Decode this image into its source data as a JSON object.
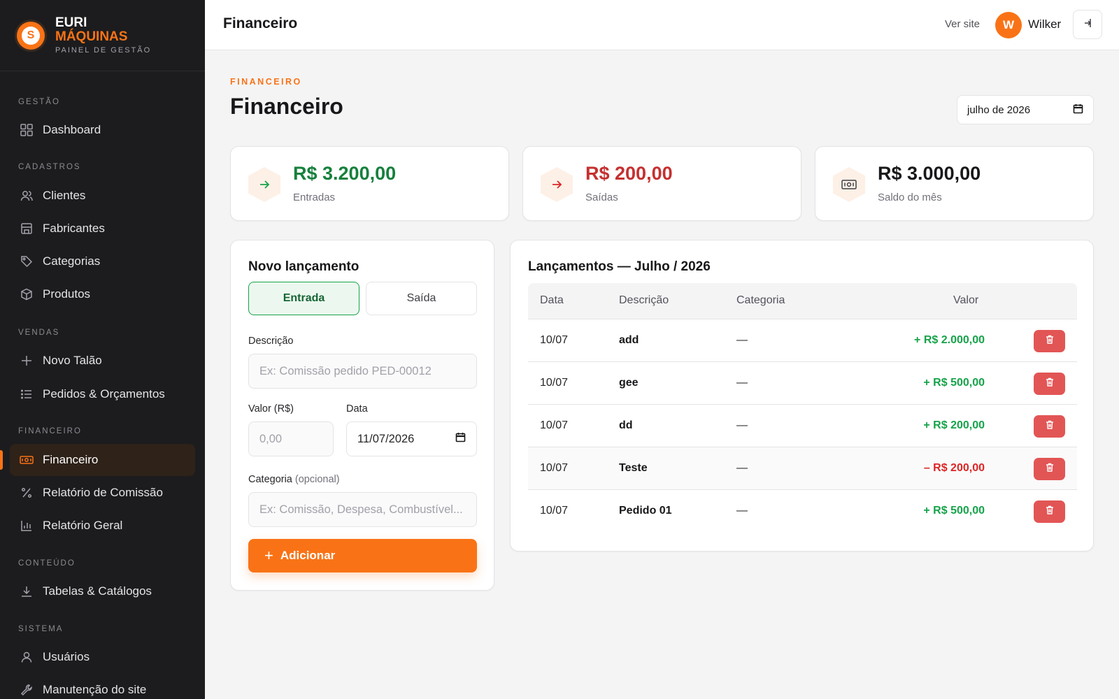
{
  "brand": {
    "line1": "EURI",
    "line2": "MÁQUINAS",
    "tagline": "PAINEL DE GESTÃO",
    "logo_letter": "S"
  },
  "sidebar": {
    "sections": {
      "gestao": "GESTÃO",
      "cadastros": "CADASTROS",
      "vendas": "VENDAS",
      "financeiro": "FINANCEIRO",
      "conteudo": "CONTEÚDO",
      "sistema": "SISTEMA"
    },
    "items": {
      "dashboard": "Dashboard",
      "clientes": "Clientes",
      "fabricantes": "Fabricantes",
      "categorias": "Categorias",
      "produtos": "Produtos",
      "novo_talao": "Novo Talão",
      "pedidos": "Pedidos & Orçamentos",
      "financeiro": "Financeiro",
      "relatorio_comissao": "Relatório de Comissão",
      "relatorio_geral": "Relatório Geral",
      "tabelas": "Tabelas & Catálogos",
      "usuarios": "Usuários",
      "manutencao": "Manutenção do site"
    },
    "active_item": "financeiro"
  },
  "topbar": {
    "title": "Financeiro",
    "ver_site": "Ver site",
    "user_initial": "W",
    "user_name": "Wilker"
  },
  "page": {
    "breadcrumb": "FINANCEIRO",
    "title": "Financeiro",
    "month_value": "julho de 2026"
  },
  "stats": [
    {
      "value": "R$ 3.200,00",
      "label": "Entradas",
      "color": "#16803c",
      "icon": "arrow-right-icon"
    },
    {
      "value": "R$ 200,00",
      "label": "Saídas",
      "color": "#c53030",
      "icon": "arrow-right-icon"
    },
    {
      "value": "R$ 3.000,00",
      "label": "Saldo do mês",
      "color": "#18181b",
      "icon": "banknote-icon"
    }
  ],
  "form": {
    "title": "Novo lançamento",
    "type_entrada": "Entrada",
    "type_saida": "Saída",
    "selected_type": "Entrada",
    "descricao_label": "Descrição",
    "descricao_placeholder": "Ex: Comissão pedido PED-00012",
    "valor_label": "Valor (R$)",
    "valor_placeholder": "0,00",
    "data_label": "Data",
    "data_value": "11/07/2026",
    "categoria_label": "Categoria",
    "categoria_optional": "(opcional)",
    "categoria_placeholder": "Ex: Comissão, Despesa, Combustível...",
    "submit_label": "Adicionar"
  },
  "table": {
    "title": "Lançamentos — Julho / 2026",
    "columns": {
      "data": "Data",
      "descricao": "Descrição",
      "categoria": "Categoria",
      "valor": "Valor"
    },
    "rows": [
      {
        "data": "10/07",
        "descricao": "add",
        "categoria": "—",
        "valor": "+ R$ 2.000,00",
        "tipo": "entrada"
      },
      {
        "data": "10/07",
        "descricao": "gee",
        "categoria": "—",
        "valor": "+ R$ 500,00",
        "tipo": "entrada"
      },
      {
        "data": "10/07",
        "descricao": "dd",
        "categoria": "—",
        "valor": "+ R$ 200,00",
        "tipo": "entrada"
      },
      {
        "data": "10/07",
        "descricao": "Teste",
        "categoria": "—",
        "valor": "– R$ 200,00",
        "tipo": "saida"
      },
      {
        "data": "10/07",
        "descricao": "Pedido 01",
        "categoria": "—",
        "valor": "+ R$ 500,00",
        "tipo": "entrada"
      }
    ]
  },
  "colors": {
    "accent": "#f97316",
    "positive": "#16a34a",
    "negative": "#dc2626",
    "sidebar_bg": "#1c1c1e"
  }
}
